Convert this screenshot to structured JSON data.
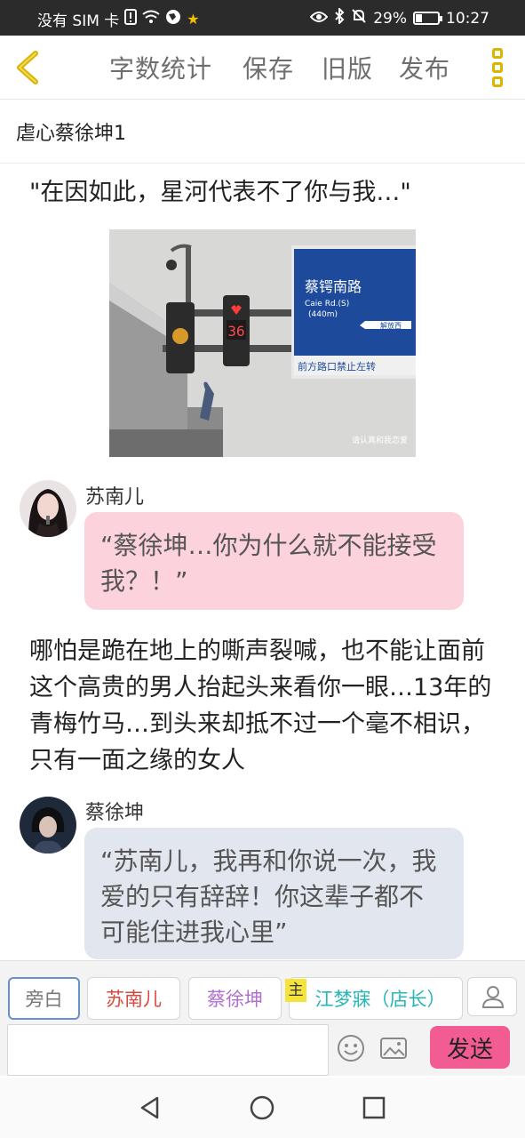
{
  "status_bar": {
    "carrier": "没有 SIM 卡",
    "battery": "29%",
    "battery_level": 0.29,
    "time": "10:27",
    "icons": [
      "sim-alert-icon",
      "wifi-icon",
      "vpn-icon",
      "star-icon",
      "eye-icon",
      "bluetooth-icon",
      "mute-icon",
      "battery-icon"
    ]
  },
  "toolbar": {
    "back_icon": "chevron-left-icon",
    "word_count": "字数统计",
    "save": "保存",
    "old_version": "旧版",
    "publish": "发布",
    "menu_icon": "more-vertical-icon",
    "accent": "#d9b400"
  },
  "document": {
    "title": "虐心蔡徐坤1"
  },
  "content": {
    "opening_quote": "\"在因如此，星河代表不了你与我…\"",
    "photo": {
      "street_sign": "蔡锷南路",
      "street_sign_en": "Caie Rd.(S)",
      "distance": "(440m)",
      "direction": "解放西",
      "sign_notice": "前方路口禁止左转",
      "countdown": "36",
      "watermark": "请认真和我恋爱"
    },
    "messages": [
      {
        "speaker": "苏南儿",
        "text": "“蔡徐坤…你为什么就不能接受我？！”",
        "bubble_color": "#fcd3dc"
      },
      {
        "speaker": "蔡徐坤",
        "text": "“苏南儿，我再和你说一次，我爱的只有辞辞！你这辈子都不可能住进我心里”",
        "bubble_color": "#e2e7ef"
      }
    ],
    "narration": "哪怕是跪在地上的嘶声裂喊，也不能让面前这个高贵的男人抬起头来看你一眼…13年的青梅竹马…到头来却抵不过一个毫不相识，只有一面之缘的女人"
  },
  "composer": {
    "roles": [
      {
        "label": "旁白",
        "color": "#777777"
      },
      {
        "label": "苏南儿",
        "color": "#e0473c"
      },
      {
        "label": "蔡徐坤",
        "color": "#b06fd0"
      },
      {
        "label": "江梦寐（店长）",
        "color": "#27b5b5"
      }
    ],
    "host_badge": "主",
    "input_value": "",
    "emoji_icon": "emoji-icon",
    "image_icon": "image-icon",
    "profile_icon": "user-icon",
    "send": "发送",
    "send_color": "#f25c93"
  },
  "nav_bar": {
    "icons": [
      "back-triangle-icon",
      "home-circle-icon",
      "recents-square-icon"
    ]
  }
}
